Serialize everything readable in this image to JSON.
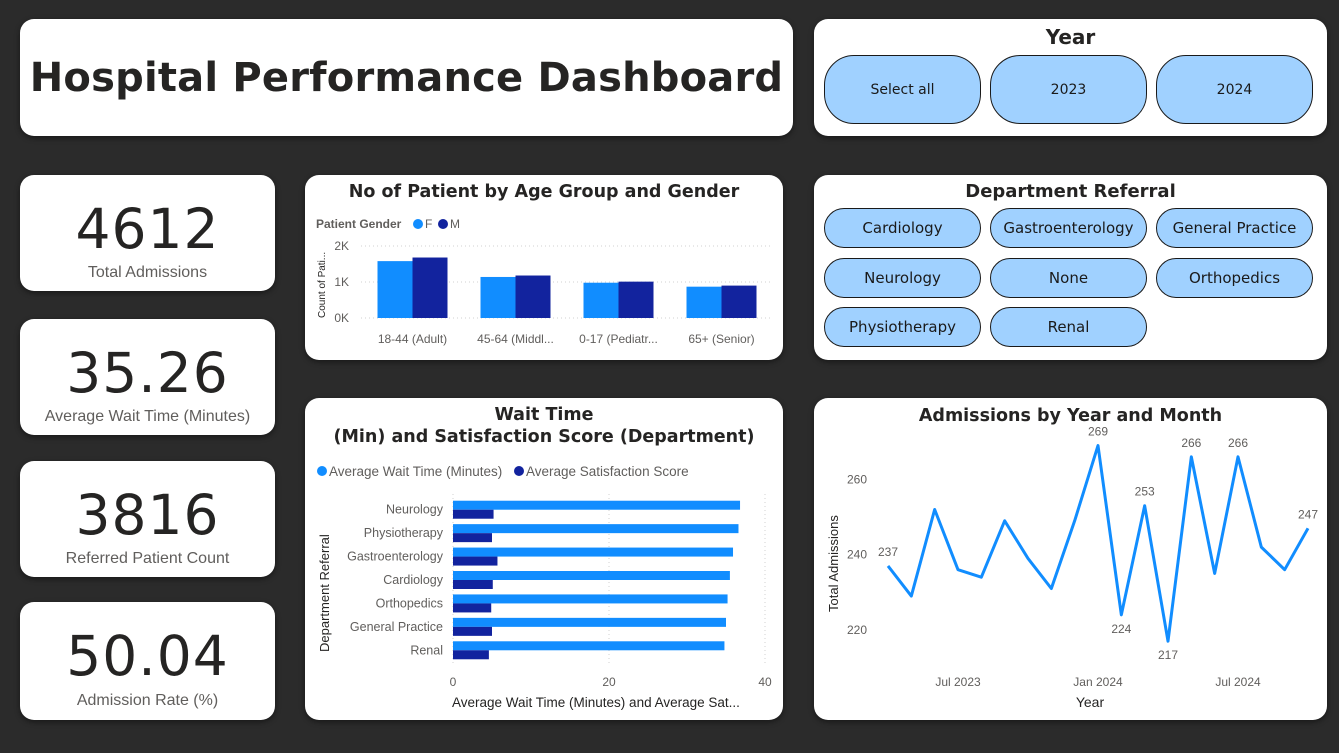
{
  "header": {
    "title": "Hospital Performance Dashboard"
  },
  "year_slicer": {
    "title": "Year",
    "options": [
      "Select all",
      "2023",
      "2024"
    ]
  },
  "dept_slicer": {
    "title": "Department Referral",
    "options": [
      "Cardiology",
      "Gastroenterology",
      "General Practice",
      "Neurology",
      "None",
      "Orthopedics",
      "Physiotherapy",
      "Renal"
    ]
  },
  "kpis": [
    {
      "value": "4612",
      "label": "Total Admissions"
    },
    {
      "value": "35.26",
      "label": "Average Wait Time (Minutes)"
    },
    {
      "value": "3816",
      "label": "Referred Patient Count"
    },
    {
      "value": "50.04",
      "label": "Admission Rate (%)"
    }
  ],
  "colors": {
    "female": "#118dff",
    "male": "#12239e",
    "line": "#118dff",
    "pill": "#a0d1ff",
    "background": "#2b2b2b"
  },
  "chart_data": [
    {
      "type": "bar",
      "title": "No of Patient by Age Group and Gender",
      "legend_title": "Patient Gender",
      "legend_placement": "top-left",
      "ylabel": "Count of Pati...",
      "xlabel": "",
      "categories": [
        "18-44 (Adult)",
        "45-64 (Middl...",
        "0-17 (Pediatr...",
        "65+ (Senior)"
      ],
      "series": [
        {
          "name": "F",
          "values": [
            1580,
            1140,
            980,
            870
          ]
        },
        {
          "name": "M",
          "values": [
            1680,
            1180,
            1010,
            900
          ]
        }
      ],
      "ylim": [
        0,
        2000
      ],
      "y_ticks": [
        "0K",
        "1K",
        "2K"
      ],
      "grid": true
    },
    {
      "type": "bar",
      "orientation": "horizontal",
      "title": "Wait Time (Min) and Satisfaction Score (Department)",
      "legend_placement": "top-left",
      "ylabel": "Department Referral",
      "xlabel": "Average Wait Time (Minutes) and Average Sat...",
      "categories": [
        "Neurology",
        "Physiotherapy",
        "Gastroenterology",
        "Cardiology",
        "Orthopedics",
        "General Practice",
        "Renal"
      ],
      "series": [
        {
          "name": "Average Wait Time (Minutes)",
          "values": [
            36.8,
            36.6,
            35.9,
            35.5,
            35.2,
            35.0,
            34.8
          ]
        },
        {
          "name": "Average Satisfaction Score",
          "values": [
            5.2,
            5.0,
            5.7,
            5.1,
            4.9,
            5.0,
            4.6
          ]
        }
      ],
      "xlim": [
        0,
        40
      ],
      "x_ticks": [
        "0",
        "20",
        "40"
      ],
      "grid": true
    },
    {
      "type": "line",
      "title": "Admissions by Year and Month",
      "xlabel": "Year",
      "ylabel": "Total Admissions",
      "x": [
        "2023-04",
        "2023-05",
        "2023-06",
        "2023-07",
        "2023-08",
        "2023-09",
        "2023-10",
        "2023-11",
        "2023-12",
        "2024-01",
        "2024-02",
        "2024-03",
        "2024-04",
        "2024-05",
        "2024-06",
        "2024-07",
        "2024-08",
        "2024-09",
        "2024-10"
      ],
      "values": [
        237,
        229,
        252,
        236,
        234,
        249,
        239,
        231,
        249,
        269,
        224,
        253,
        217,
        266,
        235,
        266,
        242,
        236,
        247
      ],
      "x_ticks": [
        {
          "x": "2023-07",
          "label": "Jul 2023"
        },
        {
          "x": "2024-01",
          "label": "Jan 2024"
        },
        {
          "x": "2024-07",
          "label": "Jul 2024"
        }
      ],
      "y_ticks": [
        "220",
        "240",
        "260"
      ],
      "ylim": [
        212,
        271
      ],
      "data_labels": [
        {
          "index": 0,
          "text": "237"
        },
        {
          "index": 9,
          "text": "269"
        },
        {
          "index": 10,
          "text": "224"
        },
        {
          "index": 11,
          "text": "253"
        },
        {
          "index": 12,
          "text": "217"
        },
        {
          "index": 13,
          "text": "266"
        },
        {
          "index": 15,
          "text": "266"
        },
        {
          "index": 18,
          "text": "247"
        }
      ],
      "grid": false
    }
  ]
}
